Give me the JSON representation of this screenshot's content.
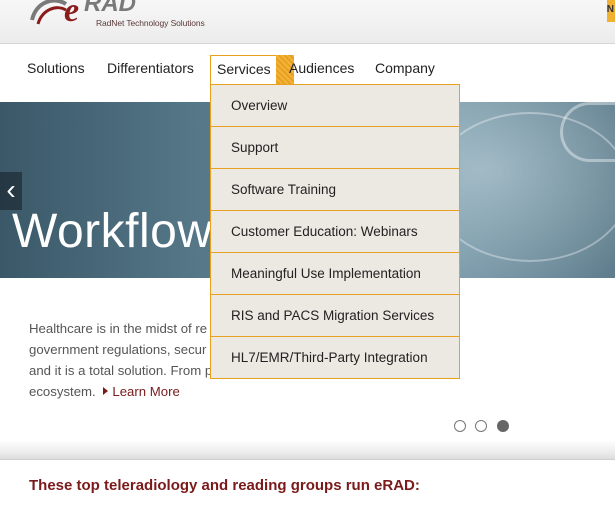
{
  "brand": {
    "logo_letter": "e",
    "logo_word": "RAD",
    "tagline": "RadNet Technology Solutions"
  },
  "corner_badge": "N",
  "nav": {
    "items": [
      {
        "label": "Solutions"
      },
      {
        "label": "Differentiators"
      },
      {
        "label": "Services"
      },
      {
        "label": "Audiences"
      },
      {
        "label": "Company"
      }
    ],
    "active": "Services"
  },
  "dropdown": {
    "items": [
      {
        "label": "Overview"
      },
      {
        "label": "Support"
      },
      {
        "label": "Software Training"
      },
      {
        "label": "Customer Education: Webinars"
      },
      {
        "label": "Meaningful Use Implementation"
      },
      {
        "label": "RIS and PACS Migration Services"
      },
      {
        "label": "HL7/EMR/Third-Party Integration"
      }
    ]
  },
  "hero": {
    "headline": "Workflow",
    "prev_arrow": "‹"
  },
  "intro": {
    "lines": [
      "Healthcare is in the midst of re                                                  t, cloud computing, health",
      "government regulations, secur                                                   ynamically automates the",
      "and it is a total solution. From                                                  patient appointment rem",
      "ecosystem."
    ],
    "learn_more": "Learn More"
  },
  "carousel": {
    "slide_count": 3,
    "active_index": 2
  },
  "section": {
    "title": "These top teleradiology and reading groups run eRAD:"
  },
  "colors": {
    "accent": "#e8a020",
    "brand_red": "#7a1a1a",
    "dropdown_bg": "#ece8e2"
  }
}
